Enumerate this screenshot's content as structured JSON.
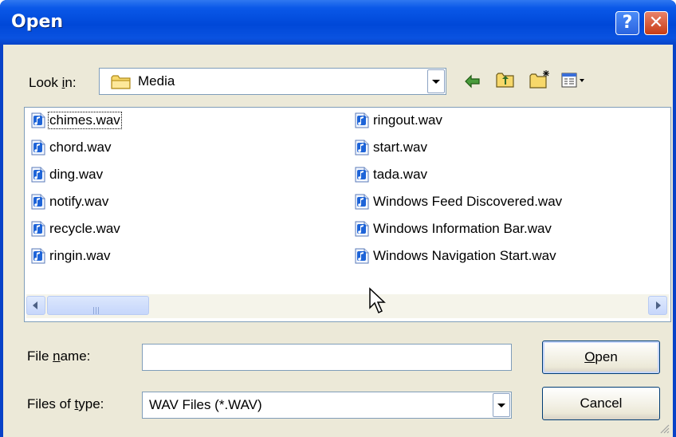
{
  "window": {
    "title": "Open",
    "help_glyph": "?",
    "close_glyph": "✕"
  },
  "lookin": {
    "label_prefix": "Look ",
    "label_accel": "i",
    "label_suffix": "n:",
    "value": "Media",
    "folder_icon": "folder-icon"
  },
  "toolbar": {
    "back_icon": "back-arrow-icon",
    "up_icon": "up-one-level-icon",
    "newfolder_icon": "new-folder-icon",
    "views_icon": "views-menu-icon"
  },
  "files": {
    "left": [
      "chimes.wav",
      "chord.wav",
      "ding.wav",
      "notify.wav",
      "recycle.wav",
      "ringin.wav"
    ],
    "right": [
      "ringout.wav",
      "start.wav",
      "tada.wav",
      "Windows Feed Discovered.wav",
      "Windows Information Bar.wav",
      "Windows Navigation Start.wav"
    ],
    "focused": "chimes.wav",
    "icon": "sound-file-icon"
  },
  "filename": {
    "label_prefix": "File ",
    "label_accel": "n",
    "label_suffix": "ame:",
    "value": ""
  },
  "filetype": {
    "label_prefix": "Files of ",
    "label_accel": "t",
    "label_suffix": "ype:",
    "value": "WAV Files (*.WAV)"
  },
  "buttons": {
    "open_accel": "O",
    "open_rest": "pen",
    "cancel": "Cancel"
  },
  "colors": {
    "titlebar": "#0a52e0",
    "dialog_bg": "#ece9d8",
    "icon_blue": "#1e64d8"
  }
}
